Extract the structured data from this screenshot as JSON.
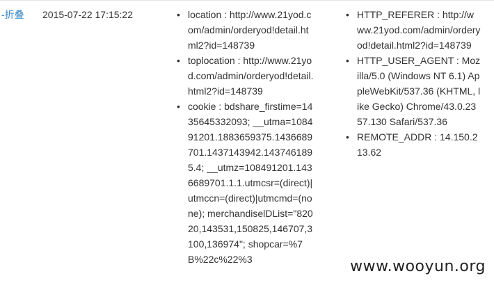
{
  "row": {
    "collapse_label": "-折叠",
    "timestamp": "2015-07-22 17:15:22"
  },
  "details_left": [
    {
      "text": "location : http://www.21yod.com/admin/orderyod!detail.html2?id=148739"
    },
    {
      "text": "toplocation : http://www.21yod.com/admin/orderyod!detail.html2?id=148739"
    },
    {
      "text": "cookie : bdshare_firstime=1435645332093; __utma=108491201.1883659375.1436689701.1437143942.1437461895.4; __utmz=108491201.1436689701.1.1.utmcsr=(direct)|utmccn=(direct)|utmcmd=(none); merchandiselDList=\"82020,143531,150825,146707,3100,136974\"; shopcar=%7B%22c%22%3"
    }
  ],
  "details_right": [
    {
      "text": "HTTP_REFERER : http://www.21yod.com/admin/orderyod!detail.html2?id=148739"
    },
    {
      "text": "HTTP_USER_AGENT : Mozilla/5.0 (Windows NT 6.1) AppleWebKit/537.36 (KHTML, like Gecko) Chrome/43.0.2357.130 Safari/537.36"
    },
    {
      "text": "REMOTE_ADDR : 14.150.213.62"
    }
  ],
  "watermark": "www.wooyun.org",
  "colors": {
    "link": "#3a87c8",
    "text": "#333333",
    "background": "#ffffff"
  }
}
